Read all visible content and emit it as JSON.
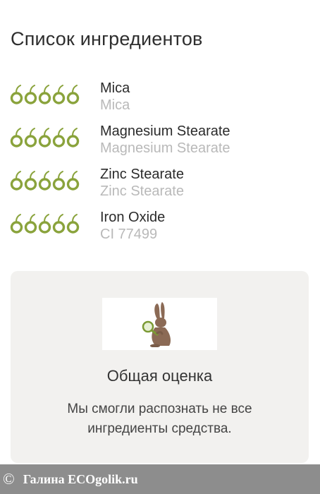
{
  "section_title": "Список ингредиентов",
  "ingredients": [
    {
      "name": "Mica",
      "inci": "Mica",
      "rating": 5
    },
    {
      "name": "Magnesium Stearate",
      "inci": "Magnesium Stearate",
      "rating": 5
    },
    {
      "name": "Zinc Stearate",
      "inci": "Zinc Stearate",
      "rating": 5
    },
    {
      "name": "Iron Oxide",
      "inci": "CI 77499",
      "rating": 5
    }
  ],
  "summary": {
    "logo_icon": "rabbit-with-magnifier-icon",
    "title": "Общая оценка",
    "text": "Мы смогли распознать не все ингредиенты средства."
  },
  "watermark": {
    "symbol": "©",
    "text": "Галина  ECOgolik.ru"
  },
  "colors": {
    "rating_green": "#8aa33c",
    "muted_text": "#b9b9b9",
    "card_bg": "#f2f1ef",
    "watermark_bg": "#8d8d8d",
    "rabbit_brown": "#8b6a55"
  }
}
